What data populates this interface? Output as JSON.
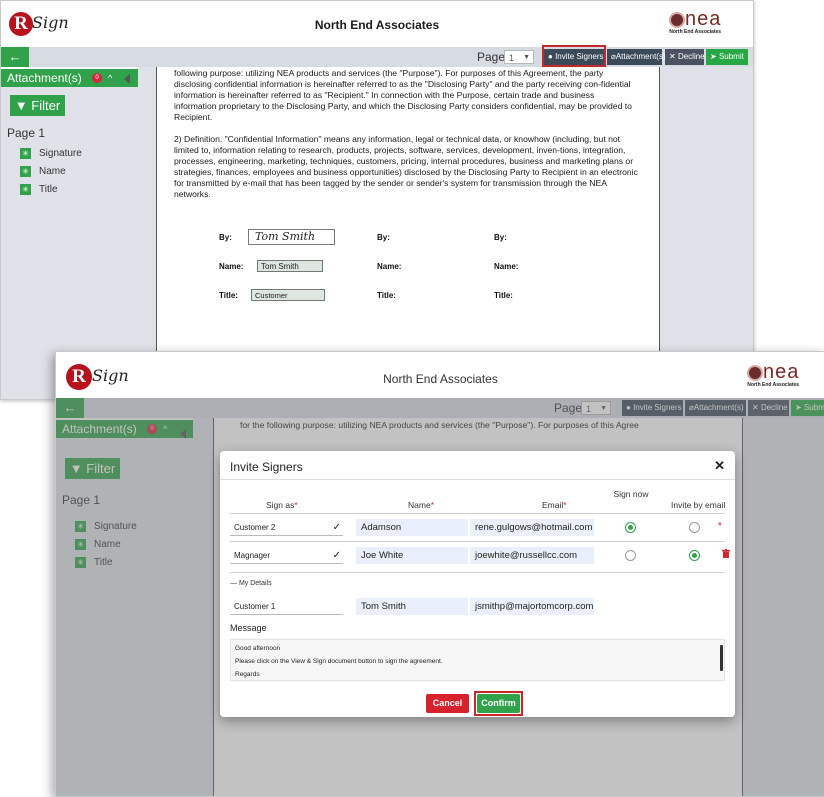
{
  "app": {
    "logo_letter": "R",
    "logo_word": "Sign",
    "title": "North End Associates",
    "brand_logo": "nea",
    "brand_sub": "North End Associates"
  },
  "toolbar": {
    "back_icon": "arrow-left-icon",
    "page_label": "Page",
    "page_value": "1",
    "invite_label": "Invite Signers",
    "attachment_label": "Attachment(s)",
    "decline_label": "Decline",
    "submit_label": "Submit"
  },
  "sidebar": {
    "attachments_label": "Attachment(s)",
    "attachments_count": "0",
    "filter_label": "Filter",
    "page_label": "Page 1",
    "items": [
      "Signature",
      "Name",
      "Title"
    ]
  },
  "document": {
    "para1": "following purpose: utilizing NEA products and services (the \"Purpose\"). For purposes of this Agreement, the party disclosing confidential information is hereinafter referred to as the \"Disclosing Party\" and the party receiving con-fidential information is hereinafter referred to as \"Recipient.\" In connection with the Purpose, certain trade and business information proprietary to the Disclosing Party, and which the Disclosing Party considers confidential, may be provided to Recipient.",
    "para2": "2) Definition. \"Confidential Information\" means any information, legal or technical data, or knowhow (including, but not limited to, information relating to research, products, projects, software, services, development, inven-tions, integration, processes, engineering, marketing, techniques, customers, pricing, internal procedures, business and marketing plans or strategies, finances, employees and business opportunities) disclosed by the Disclosing Party to Recipient in an electronic for transmitted by e-mail that has been tagged by the sender or sender's system for transmission through the NEA networks.",
    "by_label": "By:",
    "name_label": "Name:",
    "title_label": "Title:",
    "signature_value": "Tom Smith",
    "name_value": "Tom Smith",
    "title_value": "Customer",
    "back_text": "for the following purpose: utilizing NEA products and services (the \"Purpose\"). For purposes of this Agree"
  },
  "modal": {
    "title": "Invite Signers",
    "close_icon": "close-icon",
    "headers": {
      "sign_as": "Sign as",
      "name": "Name",
      "email": "Email",
      "sign_now": "Sign now",
      "invite_by_email": "Invite by email",
      "required_mark": "*"
    },
    "rows": [
      {
        "sign_as": "Customer 2",
        "name": "Adamson",
        "email": "rene.gulgows@hotmail.com",
        "sign_now": true,
        "invite_by_email": false
      },
      {
        "sign_as": "Magnager",
        "name": "Joe White",
        "email": "joewhite@russellcc.com",
        "sign_now": false,
        "invite_by_email": true
      }
    ],
    "my_details_label": "— My Details",
    "my_details": {
      "sign_as": "Customer 1",
      "name": "Tom Smith",
      "email": "jsmithp@majortomcorp.com"
    },
    "message_label": "Message",
    "message_lines": [
      "Good afternoon",
      "Please click on the View & Sign document button to sign  the agreement.",
      "Regards"
    ],
    "cancel_label": "Cancel",
    "confirm_label": "Confirm"
  },
  "colors": {
    "green": "#2fa24a",
    "red": "#d6222c",
    "highlight": "#c8252c",
    "toolbar_bg": "#d7dce3"
  }
}
